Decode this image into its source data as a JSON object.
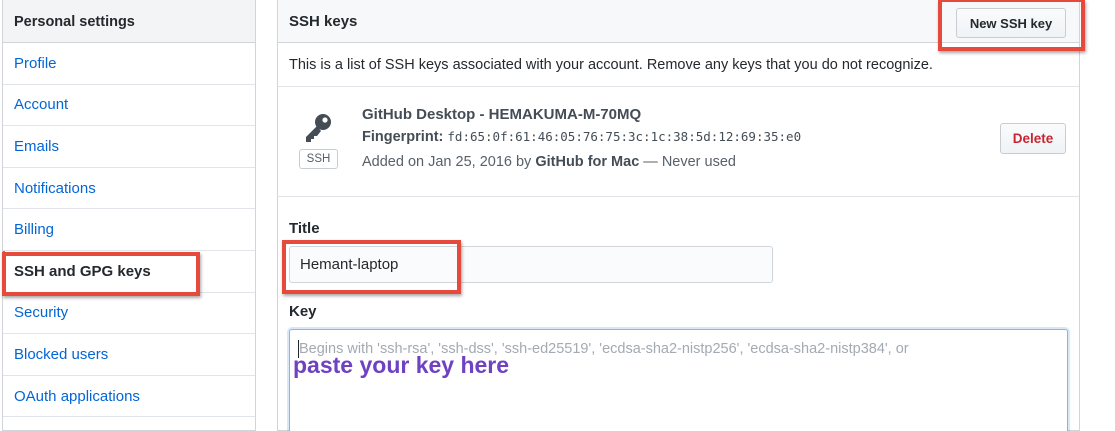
{
  "sidebar": {
    "header": "Personal settings",
    "items": [
      {
        "label": "Profile"
      },
      {
        "label": "Account"
      },
      {
        "label": "Emails"
      },
      {
        "label": "Notifications"
      },
      {
        "label": "Billing"
      },
      {
        "label": "SSH and GPG keys"
      },
      {
        "label": "Security"
      },
      {
        "label": "Blocked users"
      },
      {
        "label": "OAuth applications"
      }
    ],
    "selected": "SSH and GPG keys"
  },
  "panel": {
    "title": "SSH keys",
    "new_key_button": "New SSH key",
    "info": "This is a list of SSH keys associated with your account. Remove any keys that you do not recognize."
  },
  "key": {
    "icon": "key-icon",
    "badge": "SSH",
    "name": "GitHub Desktop - HEMAKUMA-M-70MQ",
    "fingerprint_label": "Fingerprint:",
    "fingerprint": "fd:65:0f:61:46:05:76:75:3c:1c:38:5d:12:69:35:e0",
    "added_prefix": "Added on Jan 25, 2016 by",
    "added_by": "GitHub for Mac",
    "added_suffix": "— Never used",
    "delete_button": "Delete"
  },
  "form": {
    "title_label": "Title",
    "title_value": "Hemant-laptop",
    "key_label": "Key",
    "key_placeholder": "Begins with 'ssh-rsa', 'ssh-dss', 'ssh-ed25519', 'ecdsa-sha2-nistp256', 'ecdsa-sha2-nistp384', or",
    "annotation": "paste your key here"
  },
  "colors": {
    "link": "#0366d6",
    "delete": "#cb2431",
    "highlight": "#e64a3c",
    "annotation": "#6f42c1"
  }
}
